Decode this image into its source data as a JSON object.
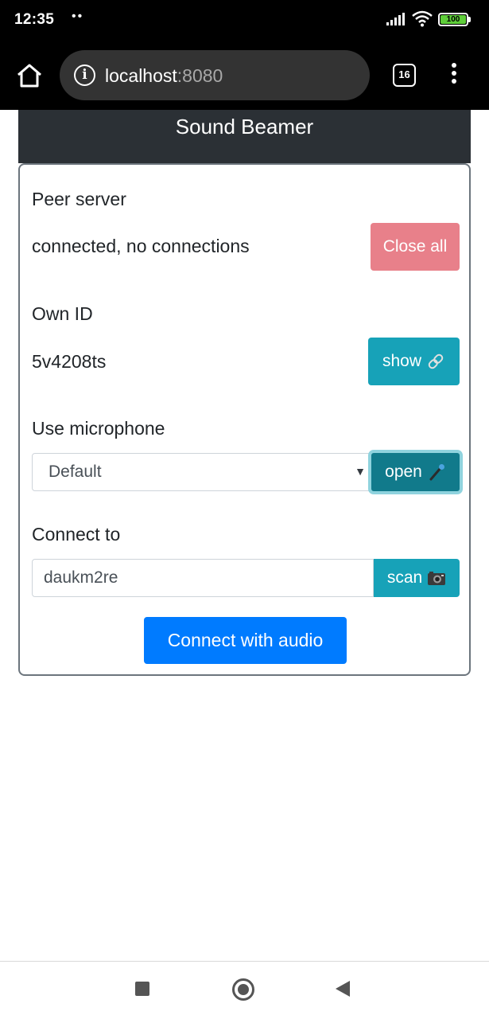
{
  "status_bar": {
    "time": "12:35",
    "dots": "••",
    "battery_level": "100",
    "icons": [
      "signal-icon",
      "wifi-icon",
      "battery-icon"
    ]
  },
  "browser": {
    "url_host": "localhost",
    "url_port": ":8080",
    "tab_count": "16",
    "icons": [
      "home-icon",
      "info-icon",
      "tabs-icon",
      "menu-icon"
    ]
  },
  "app": {
    "title": "Sound Beamer"
  },
  "peer_server": {
    "label": "Peer server",
    "status": "connected, no connections",
    "close_all_label": "Close all"
  },
  "own_id": {
    "label": "Own ID",
    "value": "5v4208ts",
    "show_label": "show",
    "show_icon": "link-icon"
  },
  "microphone": {
    "label": "Use microphone",
    "selected": "Default",
    "open_label": "open",
    "open_icon": "microphone-icon"
  },
  "connect_to": {
    "label": "Connect to",
    "value": "daukm2re",
    "scan_label": "scan",
    "scan_icon": "camera-icon"
  },
  "connect_button": {
    "label": "Connect with audio"
  },
  "colors": {
    "header_bg": "#2b3035",
    "close_all": "#e8808a",
    "info": "#17a2b8",
    "info_active": "#117a8b",
    "primary": "#007bff"
  },
  "nav_bar": {
    "icons": [
      "recent-apps-icon",
      "home-circle-icon",
      "back-icon"
    ]
  }
}
